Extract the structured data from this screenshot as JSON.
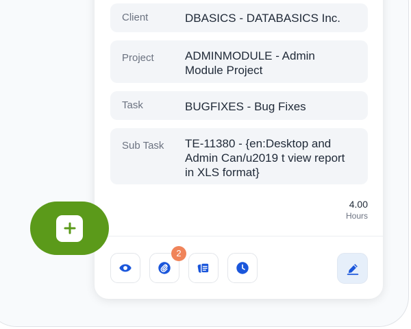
{
  "details": {
    "client": {
      "label": "Client",
      "value": "DBASICS - DATABASICS Inc."
    },
    "project": {
      "label": "Project",
      "value": "ADMINMODULE - Admin Module Project"
    },
    "task": {
      "label": "Task",
      "value": "BUGFIXES - Bug Fixes"
    },
    "subtask": {
      "label": "Sub Task",
      "value": "TE-11380 - {en:Desktop and Admin Can/u2019 t view report in XLS format}"
    }
  },
  "hours": {
    "value": "4.00",
    "unit": "Hours"
  },
  "actions": {
    "view_icon": "eye-icon",
    "attachment_icon": "paperclip-icon",
    "attachment_count": "2",
    "notes_icon": "notes-icon",
    "history_icon": "clock-icon",
    "edit_icon": "pencil-icon",
    "add_icon": "plus-icon"
  },
  "colors": {
    "accent_blue": "#1a56db",
    "fab_green": "#5b9a1a",
    "badge_orange": "#f0845a"
  }
}
